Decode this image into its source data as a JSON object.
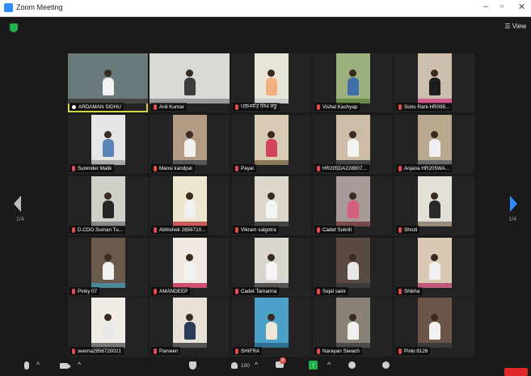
{
  "window": {
    "title": "Zoom Meeting",
    "minimize": "–",
    "maximize": "▫",
    "close": "✕"
  },
  "view_label": "☰ View",
  "nav": {
    "page_left": "1/4",
    "page_right": "1/4"
  },
  "accent": {
    "active_speaker": "#d4d64a",
    "muted": "#e54b4b",
    "brand": "#2d8cff",
    "end": "#e02828"
  },
  "participants": [
    {
      "name": "ARDAMAN SIDHU",
      "host": true,
      "muted": false,
      "bg": "#6a7a7c",
      "shirt": "#f2f2f2",
      "mat": "#444"
    },
    {
      "name": "Anil Kumar",
      "muted": true,
      "bg": "#d8dad6",
      "shirt": "#3c3c3c",
      "mat": "#999"
    },
    {
      "name": "ਪਰਮਜੀਤ ਸਿੰਘ ਸੰਧੂ",
      "muted": true,
      "bg": "#e9e4d8",
      "shirt": "#f1b07e",
      "mat": "#ccc"
    },
    {
      "name": "Vishal Kashyap",
      "muted": true,
      "bg": "#9cb07d",
      "shirt": "#3e6fa8",
      "mat": "#6b8a4a"
    },
    {
      "name": "Sonu Rani-HR095...",
      "muted": true,
      "bg": "#cdbfae",
      "shirt": "#1d1d1d",
      "mat": "#d05a8a"
    },
    {
      "name": "Surender Malik",
      "muted": true,
      "bg": "#e6e6e6",
      "shirt": "#5b83b6",
      "mat": "#aaa"
    },
    {
      "name": "Mansi kandpal",
      "muted": true,
      "bg": "#b39a84",
      "shirt": "#f0f0f0",
      "mat": "#555"
    },
    {
      "name": "Payal",
      "muted": true,
      "bg": "#d9cbb4",
      "shirt": "#d0455a",
      "mat": "#8a7a5a"
    },
    {
      "name": "HR205DA228807...",
      "muted": true,
      "bg": "#cdbca6",
      "shirt": "#f2f2f2",
      "mat": "#444"
    },
    {
      "name": "Anjana HR205WA...",
      "muted": true,
      "bg": "#b9a98f",
      "shirt": "#efefef",
      "mat": "#6a6a6a"
    },
    {
      "name": "D.CDO Suman Tu...",
      "muted": true,
      "bg": "#cfd0c8",
      "shirt": "#262626",
      "mat": "#888"
    },
    {
      "name": "Abhishek 2856710...",
      "muted": true,
      "bg": "#ede6cf",
      "shirt": "#f0f0f0",
      "mat": "#c85a5a"
    },
    {
      "name": "Vikram salgotra",
      "muted": true,
      "bg": "#dcd6cc",
      "shirt": "#f4f4f4",
      "mat": "#444"
    },
    {
      "name": "Cadet Sukriti",
      "muted": true,
      "bg": "#a89a98",
      "shirt": "#d46080",
      "mat": "#7a4a4a"
    },
    {
      "name": "Shruti",
      "muted": true,
      "bg": "#e4e0d8",
      "shirt": "#2a2a2a",
      "mat": "#9a8a7a"
    },
    {
      "name": "Pinky 07",
      "muted": true,
      "bg": "#6a5a4c",
      "shirt": "#f0f0f0",
      "mat": "#4a8a9a"
    },
    {
      "name": "AMANDEEP",
      "muted": true,
      "bg": "#efe9e2",
      "shirt": "#f2f2f2",
      "mat": "#d05070"
    },
    {
      "name": "Cadet Tamanna",
      "muted": true,
      "bg": "#d8d6ce",
      "shirt": "#f5f5f5",
      "mat": "#555"
    },
    {
      "name": "Sejal saini",
      "muted": true,
      "bg": "#5a4a44",
      "shirt": "#e8e8e8",
      "mat": "#3a3a3a"
    },
    {
      "name": "Shikha",
      "muted": true,
      "bg": "#d9c8b2",
      "shirt": "#f0f0f0",
      "mat": "#c05a7a"
    },
    {
      "name": "seema2956720021",
      "muted": true,
      "bg": "#f0ece6",
      "shirt": "#e8e8e8",
      "mat": "#777"
    },
    {
      "name": "Parveen",
      "muted": true,
      "bg": "#e6e0d6",
      "shirt": "#2c3a5a",
      "mat": "#555"
    },
    {
      "name": "SHIFRA",
      "muted": true,
      "bg": "#4aa0c8",
      "shirt": "#f0e6d8",
      "mat": "#2f6f8f"
    },
    {
      "name": "Narayan Siwach",
      "muted": true,
      "bg": "#8a8276",
      "shirt": "#f0f0f0",
      "mat": "#4a4a4a"
    },
    {
      "name": "Pinki 8126",
      "muted": true,
      "bg": "#6a5548",
      "shirt": "#f2f2f2",
      "mat": "#3a3a3a"
    }
  ],
  "toolbar": {
    "participant_count": "100",
    "chat_badge": "8",
    "caret": "^"
  }
}
